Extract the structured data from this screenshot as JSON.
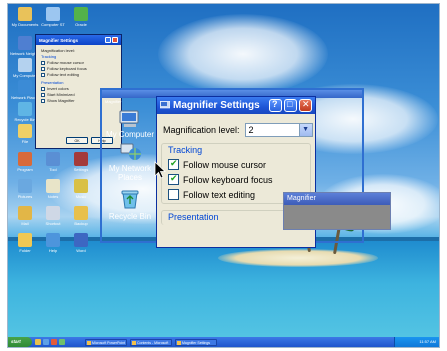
{
  "desktop": {
    "small_icons": [
      {
        "label": "My Documents",
        "color": "#e9c25a"
      },
      {
        "label": "Computer ST",
        "color": "#9cc6f0"
      },
      {
        "label": "Oracle",
        "color": "#53b24a"
      },
      {
        "label": "Network Neighbors",
        "color": "#4f7fd1"
      },
      {
        "label": "My Computer",
        "color": "#b4d2ef"
      },
      {
        "label": "Network Places",
        "color": "#3b8bd6"
      },
      {
        "label": "Recycle Bin",
        "color": "#5fb5e5"
      },
      {
        "label": "File",
        "color": "#f0d067"
      },
      {
        "label": "Program",
        "color": "#d86a3a"
      },
      {
        "label": "Tool",
        "color": "#5a8fd4"
      },
      {
        "label": "Settings",
        "color": "#a43a3a"
      },
      {
        "label": "Pictures",
        "color": "#6aa8e0"
      },
      {
        "label": "Notes",
        "color": "#e8e4c8"
      },
      {
        "label": "Music",
        "color": "#d9c046"
      },
      {
        "label": "Mail",
        "color": "#e2b647"
      },
      {
        "label": "Shortcut",
        "color": "#cfd8e6"
      },
      {
        "label": "Backup",
        "color": "#e8c04d"
      },
      {
        "label": "Folder",
        "color": "#f0c853"
      },
      {
        "label": "Help",
        "color": "#4d95dc"
      },
      {
        "label": "Word",
        "color": "#3d67c2"
      }
    ]
  },
  "small_window": {
    "title": "Magnifier Settings",
    "level_label": "Magnification level:",
    "tracking": "Tracking",
    "items": [
      "Follow mouse cursor",
      "Follow keyboard focus",
      "Follow text editing"
    ],
    "presentation": "Presentation",
    "pres_items": [
      "Invert colors",
      "Start Minimized",
      "Show Magnifier"
    ],
    "ok": "OK",
    "help": "Help"
  },
  "magnified": {
    "desktop_icons": [
      {
        "label": "My Computer",
        "color": "#b4d2ef"
      },
      {
        "label": "My Network Places",
        "color": "#3b8bd6"
      },
      {
        "label": "Recycle Bin",
        "color": "#5fb5e5"
      }
    ],
    "settings_window": {
      "title": "Magnifier Settings",
      "level_label": "Magnification level:",
      "level_value": "2",
      "tracking_header": "Tracking",
      "options": [
        {
          "label": "Follow mouse cursor",
          "checked": true
        },
        {
          "label": "Follow keyboard focus",
          "checked": true
        },
        {
          "label": "Follow text editing",
          "checked": false
        }
      ],
      "presentation_header": "Presentation"
    },
    "mirror_title": "Magnifier"
  },
  "magnifier_window": {
    "title": "Magnifier"
  },
  "taskbar": {
    "start_label": "start",
    "quick_launch_colors": [
      "#e8c04d",
      "#5fa0e6",
      "#e25a3a",
      "#6fc06a"
    ],
    "buttons": [
      "Microsoft PowerPoint",
      "Contents - Microsoft",
      "Magnifier Settings"
    ],
    "clock": "11:57 AM"
  }
}
